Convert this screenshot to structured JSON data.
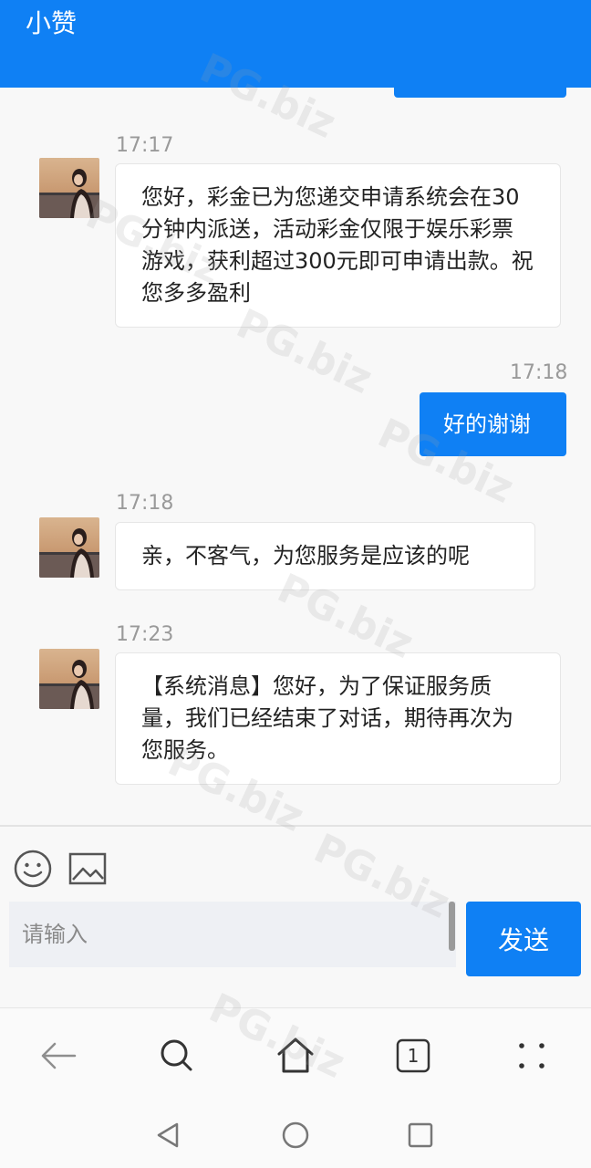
{
  "header": {
    "title": "小赞"
  },
  "messages": [
    {
      "time": "17:17",
      "from": "agent",
      "text": "您好，彩金已为您递交申请系统会在30分钟内派送，活动彩金仅限于娱乐彩票游戏，获利超过300元即可申请出款。祝您多多盈利"
    },
    {
      "time": "17:18",
      "from": "user",
      "text": "好的谢谢"
    },
    {
      "time": "17:18",
      "from": "agent",
      "text": "亲，不客气，为您服务是应该的呢"
    },
    {
      "time": "17:23",
      "from": "agent",
      "text": "【系统消息】您好，为了保证服务质量，我们已经结束了对话，期待再次为您服务。"
    }
  ],
  "input": {
    "placeholder": "请输入",
    "value": ""
  },
  "send_label": "发送",
  "browser_nav": {
    "tab_count": "1"
  },
  "watermark": "PG.biz",
  "colors": {
    "accent": "#0f80f4",
    "background": "#f8f8f8",
    "bubble_in": "#ffffff"
  }
}
